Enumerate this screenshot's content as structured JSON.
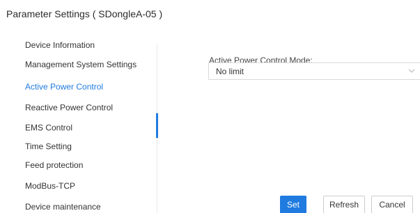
{
  "page": {
    "title": "Parameter Settings ( SDongleA-05 )"
  },
  "sidebar": {
    "items": [
      {
        "label": "Device Information"
      },
      {
        "label": "Management System Settings"
      },
      {
        "label": "Active Power Control",
        "active": true
      },
      {
        "label": "Reactive Power Control"
      },
      {
        "label": "EMS Control"
      },
      {
        "label": "Time Setting"
      },
      {
        "label": "Feed protection"
      },
      {
        "label": "ModBus-TCP"
      },
      {
        "label": "Device maintenance"
      }
    ]
  },
  "form": {
    "active_power_mode": {
      "label": "Active Power Control Mode:",
      "value": "No limit"
    }
  },
  "actions": {
    "set_label": "Set",
    "refresh_label": "Refresh",
    "cancel_label": "Cancel"
  },
  "colors": {
    "accent": "#1f7be0",
    "text": "#333333",
    "border": "#d9d9d9"
  },
  "icons": {
    "select_arrow": "chevron-down-icon"
  }
}
